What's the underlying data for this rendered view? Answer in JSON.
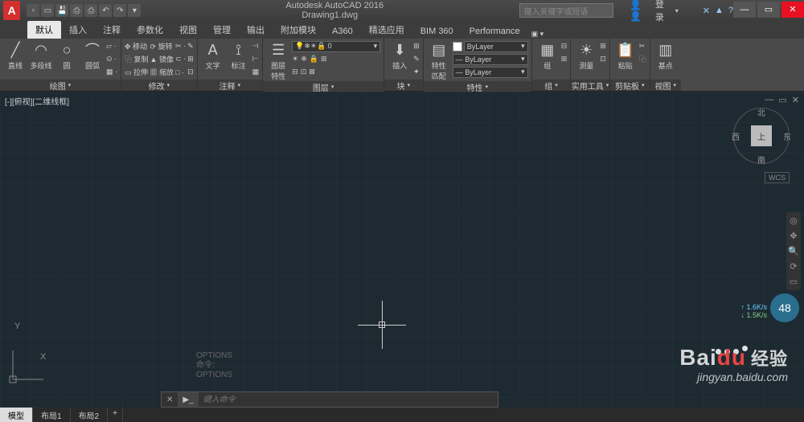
{
  "title": {
    "app": "Autodesk AutoCAD 2016",
    "file": "Drawing1.dwg"
  },
  "search": {
    "placeholder": "键入关键字或短语"
  },
  "user": {
    "label": "登录"
  },
  "tabs": [
    "默认",
    "插入",
    "注释",
    "参数化",
    "视图",
    "管理",
    "输出",
    "附加模块",
    "A360",
    "精选应用",
    "BIM 360",
    "Performance"
  ],
  "activeTab": 0,
  "panels": {
    "draw": {
      "title": "绘图",
      "big": [
        {
          "icon": "╱",
          "label": "直线"
        },
        {
          "icon": "◠",
          "label": "多段线"
        },
        {
          "icon": "○",
          "label": "圆"
        },
        {
          "icon": "⌒",
          "label": "圆弧"
        }
      ]
    },
    "modify": {
      "title": "修改",
      "rows": [
        [
          "✥ 移动",
          "⟳ 旋转",
          "✂ ·"
        ],
        [
          "⿻ 复制",
          "▲ 镜像",
          "⊂ ·"
        ],
        [
          "▭ 拉伸",
          "▦ 缩放",
          "□ ·"
        ]
      ]
    },
    "annotation": {
      "title": "注释",
      "big": [
        {
          "icon": "A",
          "label": "文字"
        },
        {
          "icon": "⟟",
          "label": "标注"
        }
      ]
    },
    "layers": {
      "title": "图层",
      "big": {
        "icon": "☰",
        "label": "图层\n特性"
      },
      "combo": "●"
    },
    "block": {
      "title": "块",
      "big": {
        "icon": "⬇",
        "label": "插入"
      }
    },
    "properties": {
      "title": "特性",
      "big": {
        "icon": "▤",
        "label": "特性\n匹配"
      },
      "rows": [
        "ByLayer",
        "ByLayer",
        "ByLayer"
      ]
    },
    "group": {
      "title": "组",
      "big": {
        "icon": "▦",
        "label": "组"
      }
    },
    "utils": {
      "title": "实用工具",
      "big": {
        "icon": "☀",
        "label": "测量"
      }
    },
    "clipboard": {
      "title": "剪贴板",
      "big": {
        "icon": "📋",
        "label": "粘贴"
      }
    },
    "base": {
      "title": "视图",
      "big": {
        "icon": "▥",
        "label": "基点"
      }
    }
  },
  "viewport": {
    "label": "[-][俯视][二维线框]",
    "viewcube": {
      "face": "上",
      "n": "北",
      "s": "南",
      "e": "东",
      "w": "西"
    },
    "wcs": "WCS"
  },
  "speed": {
    "circle": "48",
    "up": "↑ 1.6K/s",
    "down": "↓ 1.5K/s"
  },
  "history": [
    "OPTIONS",
    "命令:",
    "OPTIONS"
  ],
  "cmd": {
    "placeholder": "键入命令",
    "prompt": "▶_"
  },
  "modelTabs": [
    "模型",
    "布局1",
    "布局2"
  ],
  "ucs": {
    "x": "X",
    "y": "Y"
  },
  "watermark": {
    "brand": "Bai",
    "du": "du",
    "cn": "经验",
    "url": "jingyan.baidu.com"
  }
}
